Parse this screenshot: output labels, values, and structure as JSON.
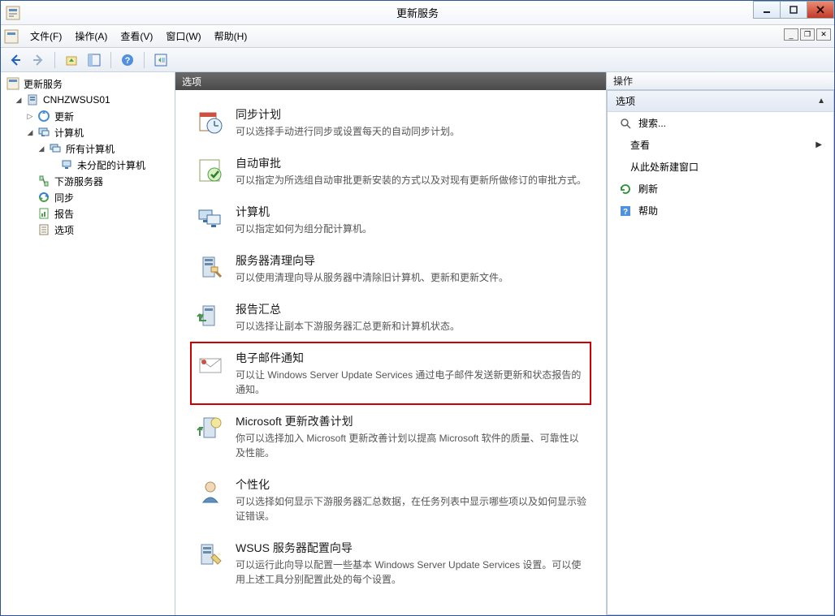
{
  "window": {
    "title": "更新服务"
  },
  "menubar": {
    "items": [
      "文件(F)",
      "操作(A)",
      "查看(V)",
      "窗口(W)",
      "帮助(H)"
    ]
  },
  "tree": {
    "root": {
      "label": "更新服务"
    },
    "server": {
      "label": "CNHZWSUS01"
    },
    "updates": {
      "label": "更新"
    },
    "computers": {
      "label": "计算机"
    },
    "all_computers": {
      "label": "所有计算机"
    },
    "unassigned": {
      "label": "未分配的计算机"
    },
    "downstream": {
      "label": "下游服务器"
    },
    "sync": {
      "label": "同步"
    },
    "report": {
      "label": "报告"
    },
    "options": {
      "label": "选项"
    }
  },
  "center": {
    "header": "选项",
    "items": [
      {
        "title": "同步计划",
        "desc": "可以选择手动进行同步或设置每天的自动同步计划。"
      },
      {
        "title": "自动审批",
        "desc": "可以指定为所选组自动审批更新安装的方式以及对现有更新所做修订的审批方式。"
      },
      {
        "title": "计算机",
        "desc": "可以指定如何为组分配计算机。"
      },
      {
        "title": "服务器清理向导",
        "desc": "可以使用清理向导从服务器中清除旧计算机、更新和更新文件。"
      },
      {
        "title": "报告汇总",
        "desc": "可以选择让副本下游服务器汇总更新和计算机状态。"
      },
      {
        "title": "电子邮件通知",
        "desc": "可以让 Windows Server Update Services 通过电子邮件发送新更新和状态报告的通知。"
      },
      {
        "title": "Microsoft 更新改善计划",
        "desc": "你可以选择加入 Microsoft 更新改善计划以提高 Microsoft 软件的质量、可靠性以及性能。"
      },
      {
        "title": "个性化",
        "desc": "可以选择如何显示下游服务器汇总数据，在任务列表中显示哪些项以及如何显示验证错误。"
      },
      {
        "title": "WSUS 服务器配置向导",
        "desc": "可以运行此向导以配置一些基本 Windows Server Update Services 设置。可以使用上述工具分别配置此处的每个设置。"
      }
    ]
  },
  "actions": {
    "header": "操作",
    "section": "选项",
    "items": {
      "search": "搜索...",
      "view": "查看",
      "new_window": "从此处新建窗口",
      "refresh": "刷新",
      "help": "帮助"
    }
  }
}
